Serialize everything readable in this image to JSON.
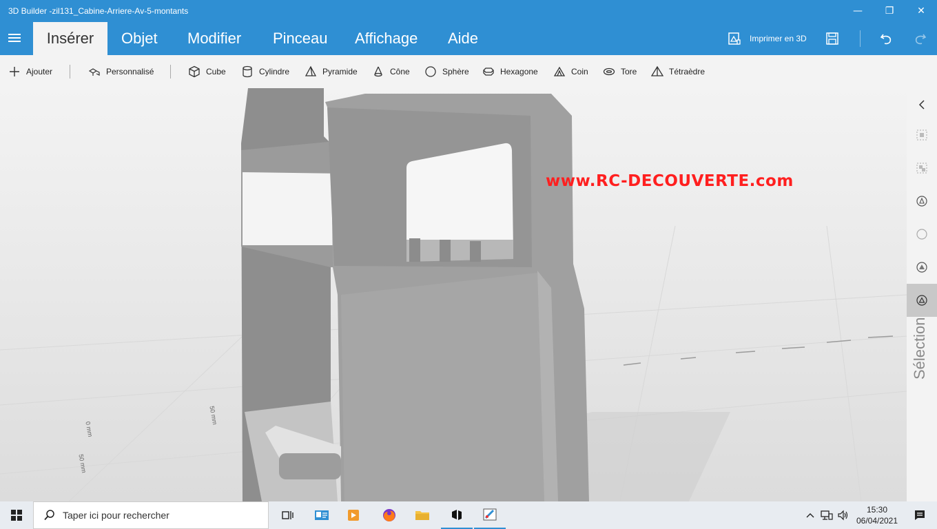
{
  "window": {
    "title": "3D Builder -zil131_Cabine-Arriere-Av-5-montants",
    "minimize": "—",
    "maximize": "❐",
    "close": "✕"
  },
  "ribbon": {
    "tabs": [
      {
        "label": "Insérer"
      },
      {
        "label": "Objet"
      },
      {
        "label": "Modifier"
      },
      {
        "label": "Pinceau"
      },
      {
        "label": "Affichage"
      },
      {
        "label": "Aide"
      }
    ],
    "print_label": "Imprimer en 3D"
  },
  "toolbar": {
    "add_label": "Ajouter",
    "custom_label": "Personnalisé",
    "shapes": [
      {
        "label": "Cube",
        "icon": "cube-icon"
      },
      {
        "label": "Cylindre",
        "icon": "cylinder-icon"
      },
      {
        "label": "Pyramide",
        "icon": "pyramid-icon"
      },
      {
        "label": "Cône",
        "icon": "cone-icon"
      },
      {
        "label": "Sphère",
        "icon": "sphere-icon"
      },
      {
        "label": "Hexagone",
        "icon": "hexagon-icon"
      },
      {
        "label": "Coin",
        "icon": "wedge-icon"
      },
      {
        "label": "Tore",
        "icon": "torus-icon"
      },
      {
        "label": "Tétraèdre",
        "icon": "tetrahedron-icon"
      }
    ]
  },
  "viewport": {
    "watermark": "www.RC-DECOUVERTE.com",
    "ruler_labels": [
      "50 mm",
      "0 mm",
      "50 mm"
    ]
  },
  "side_panel": {
    "label": "Sélection"
  },
  "taskbar": {
    "search_placeholder": "Taper ici pour rechercher",
    "time": "15:30",
    "date": "06/04/2021"
  },
  "colors": {
    "accent": "#2f8fd3",
    "watermark": "#ff1f1f"
  }
}
